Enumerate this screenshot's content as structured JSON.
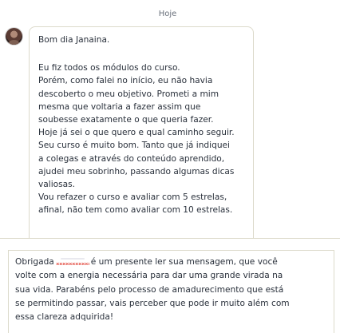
{
  "thread": {
    "date_label": "Hoje",
    "message": {
      "greeting": "Bom dia Janaina.",
      "lines": [
        "Eu fiz todos os módulos do curso.",
        "Porém, como falei no início, eu não havia",
        "descoberto o meu objetivo. Prometi a mim",
        "mesma que voltaria a fazer assim que",
        "soubesse exatamente o que queria fazer.",
        "Hoje já sei o que quero e qual caminho seguir.",
        "Seu curso é muito bom. Tanto que já indiquei",
        "a colegas e através do conteúdo aprendido,",
        "ajudei meu sobrinho, passando algumas dicas",
        "valiosas.",
        "Vou refazer o curso e avaliar com 5 estrelas,",
        "afinal, não tem como avaliar com 10 estrelas."
      ]
    }
  },
  "reply": {
    "first_line_start": "Obrigada",
    "first_line_end": "é um presente ler sua mensagem, que você",
    "lines": [
      "volte com a energia necessária para dar uma grande virada na",
      "sua vida. Parabéns pelo processo de amadurecimento que está",
      "se permitindo passar, vais perceber que pode ir muito além com",
      "essa clareza adquirida!"
    ]
  }
}
